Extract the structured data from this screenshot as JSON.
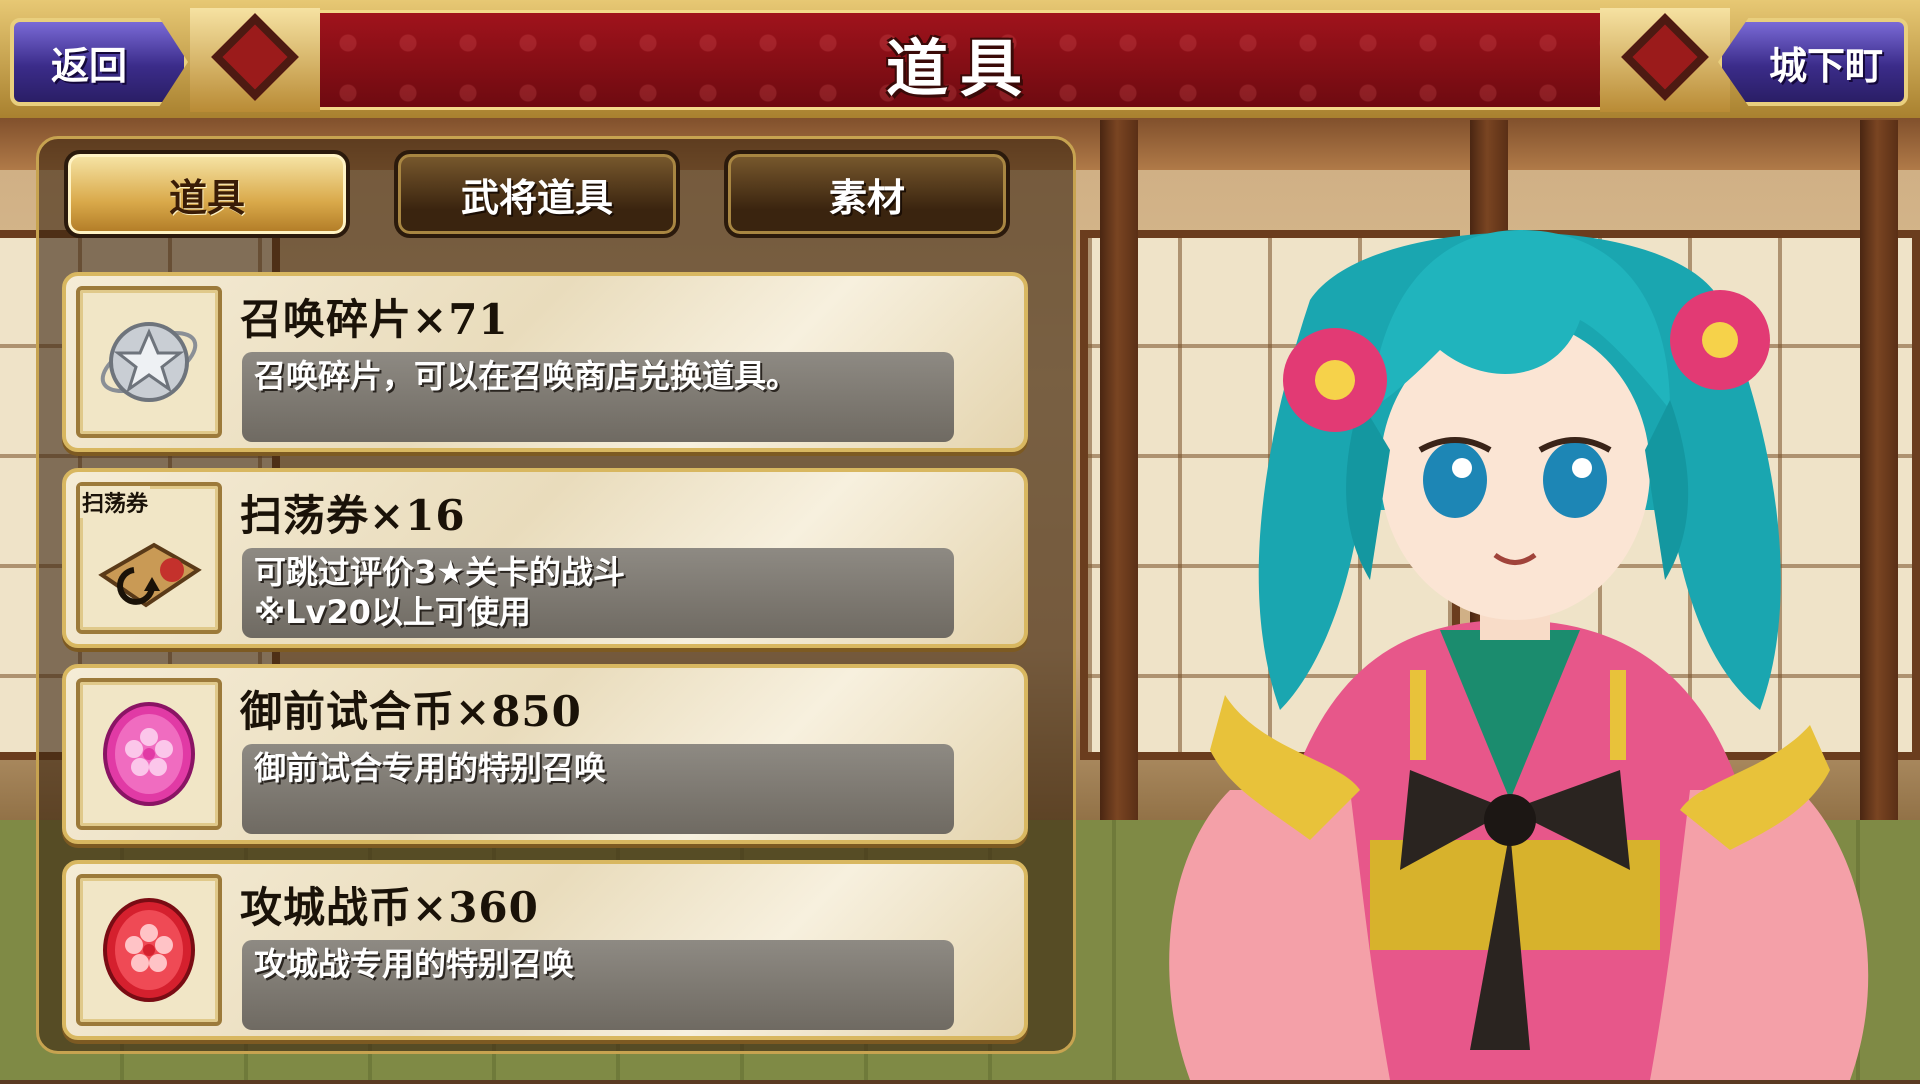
{
  "header": {
    "title": "道具",
    "back_label": "返回",
    "town_label": "城下町"
  },
  "tabs": [
    {
      "label": "道具",
      "active": true
    },
    {
      "label": "武将道具",
      "active": false
    },
    {
      "label": "素材",
      "active": false
    }
  ],
  "items": [
    {
      "name": "召唤碎片×71",
      "description": "召唤碎片，可以在召唤商店兑换道具。",
      "icon": "summon-shard-icon"
    },
    {
      "name": "扫荡券×16",
      "description": "可跳过评价3★关卡的战斗\n※Lv20以上可使用",
      "icon": "sweep-ticket-icon",
      "icon_label": "扫荡券"
    },
    {
      "name": "御前试合币×850",
      "description": "御前试合专用的特别召唤",
      "icon": "pink-coin-icon"
    },
    {
      "name": "攻城战币×360",
      "description": "攻城战专用的特别召唤",
      "icon": "red-coin-icon"
    }
  ],
  "colors": {
    "banner": "#8e1018",
    "gold": "#d8b760",
    "header_button": "#3b2c8a"
  }
}
